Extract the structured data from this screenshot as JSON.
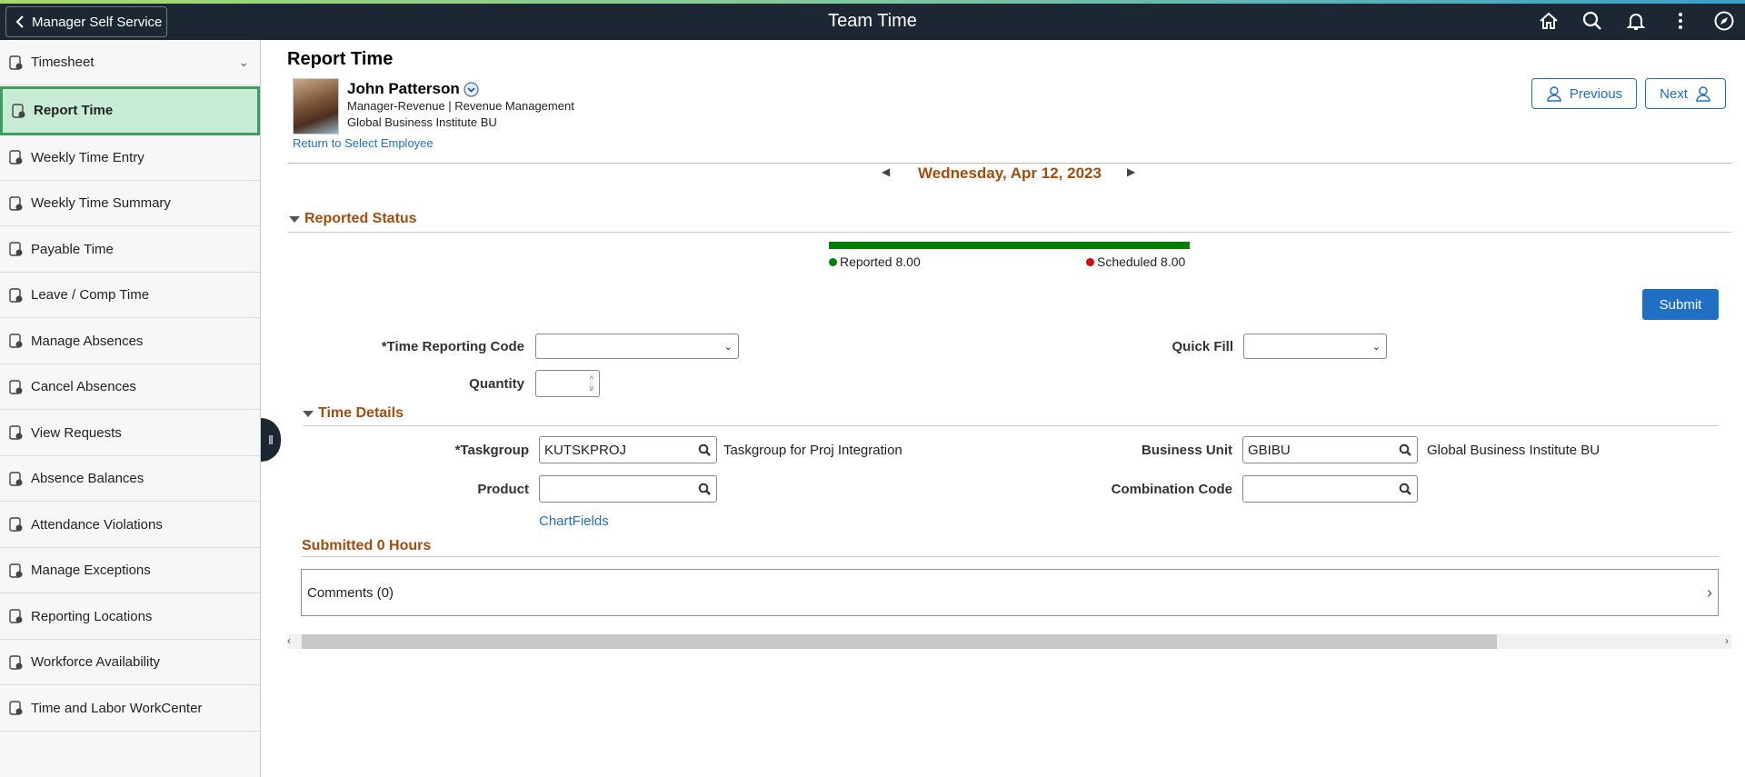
{
  "header": {
    "back_label": "Manager Self Service",
    "title": "Team Time",
    "icons": [
      "home-icon",
      "search-icon",
      "bell-icon",
      "more-icon",
      "compass-icon"
    ]
  },
  "sidebar": {
    "items": [
      {
        "label": "Timesheet",
        "icon": "timesheet-icon"
      },
      {
        "label": "Report Time",
        "icon": "report-time-icon",
        "selected": true
      },
      {
        "label": "Weekly Time Entry",
        "icon": "clock-edit-icon"
      },
      {
        "label": "Weekly Time Summary",
        "icon": "calendar-icon"
      },
      {
        "label": "Payable Time",
        "icon": "payable-icon"
      },
      {
        "label": "Leave / Comp Time",
        "icon": "scales-icon"
      },
      {
        "label": "Manage Absences",
        "icon": "briefcase-icon"
      },
      {
        "label": "Cancel Absences",
        "icon": "cancel-icon"
      },
      {
        "label": "View Requests",
        "icon": "view-icon"
      },
      {
        "label": "Absence Balances",
        "icon": "scales-icon"
      },
      {
        "label": "Attendance Violations",
        "icon": "calendar-icon"
      },
      {
        "label": "Manage Exceptions",
        "icon": "warning-icon"
      },
      {
        "label": "Reporting Locations",
        "icon": "location-icon"
      },
      {
        "label": "Workforce Availability",
        "icon": "people-icon"
      },
      {
        "label": "Time and Labor WorkCenter",
        "icon": "workcenter-icon"
      }
    ]
  },
  "page": {
    "title": "Report Time"
  },
  "employee": {
    "name": "John Patterson",
    "title_line": "Manager-Revenue | Revenue Management",
    "bu_line": "Global Business Institute BU",
    "return_link": "Return to Select Employee"
  },
  "nav": {
    "previous": "Previous",
    "next": "Next"
  },
  "date": "Wednesday, Apr 12, 2023",
  "reported_status": {
    "header": "Reported Status",
    "reported_label": "Reported 8.00",
    "scheduled_label": "Scheduled 8.00",
    "reported": 8.0,
    "scheduled": 8.0,
    "colors": {
      "bar": "#008000",
      "reported": "#008000",
      "scheduled": "#e00000"
    }
  },
  "submit_label": "Submit",
  "form": {
    "trc_label": "*Time Reporting Code",
    "trc_value": "",
    "quick_fill_label": "Quick Fill",
    "quick_fill_value": "",
    "quantity_label": "Quantity",
    "quantity_value": ""
  },
  "time_details": {
    "header": "Time Details",
    "taskgroup_label": "*Taskgroup",
    "taskgroup_value": "KUTSKPROJ",
    "taskgroup_desc": "Taskgroup for Proj Integration",
    "product_label": "Product",
    "product_value": "",
    "bu_label": "Business Unit",
    "bu_value": "GBIBU",
    "bu_desc": "Global Business Institute BU",
    "combo_label": "Combination Code",
    "combo_value": "",
    "chartfields_link": "ChartFields"
  },
  "submitted": {
    "header": "Submitted 0 Hours",
    "comments": "Comments (0)"
  }
}
